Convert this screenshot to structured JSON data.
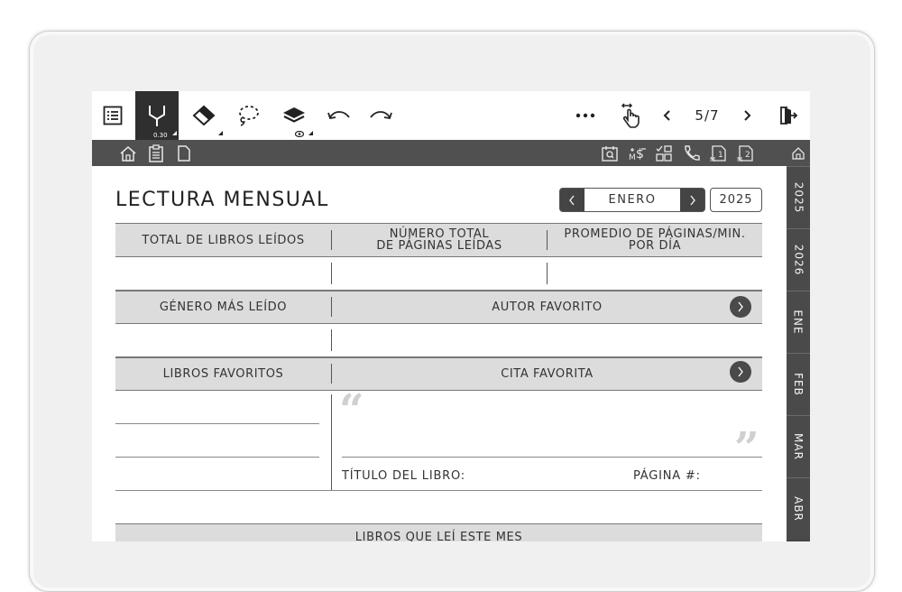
{
  "toolbar": {
    "pen_size": "0.30",
    "page_indicator": "5/7"
  },
  "page": {
    "title": "LECTURA MENSUAL",
    "month": "ENERO",
    "year": "2025"
  },
  "table": {
    "row1": {
      "col1": "TOTAL DE LIBROS LEÍDOS",
      "col2_line1": "NÚMERO TOTAL",
      "col2_line2": "DE PÁGINAS LEÍDAS",
      "col3_line1": "PROMEDIO DE PÁGINAS/MIN.",
      "col3_line2": "POR DÍA"
    },
    "row2": {
      "col1": "GÉNERO MÁS LEÍDO",
      "col2": "AUTOR FAVORITO"
    },
    "row3": {
      "col1": "LIBROS FAVORITOS",
      "col2": "CITA FAVORITA"
    },
    "quote": {
      "open_mark": "“",
      "close_mark": "”",
      "book_title_label": "TÍTULO DEL LIBRO:",
      "page_label": "PÁGINA #:"
    },
    "books_read_header": "LIBROS QUE LEÍ ESTE MES"
  },
  "side_tabs": [
    "2025",
    "2026",
    "ENE",
    "FEB",
    "MAR",
    "ABR"
  ],
  "colors": {
    "dark_bar": "#505050",
    "header_fill": "#dcdcdc",
    "tab_fill": "#4a4a4a"
  }
}
